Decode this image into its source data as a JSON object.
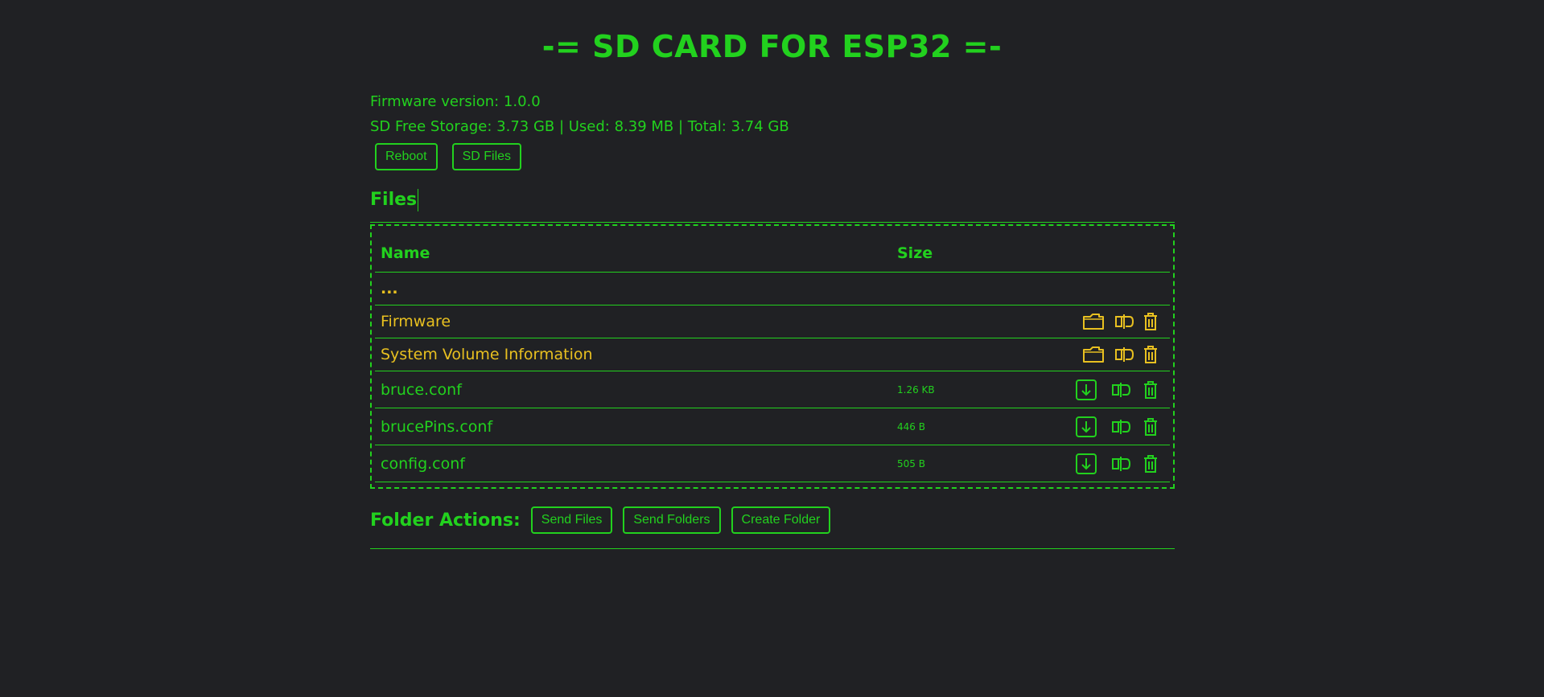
{
  "header": {
    "title": "-= SD CARD FOR ESP32 =-"
  },
  "info": {
    "firmware": "Firmware version: 1.0.0",
    "storage": "SD Free Storage: 3.73 GB | Used: 8.39 MB | Total: 3.74 GB"
  },
  "buttons": {
    "reboot": "Reboot",
    "sd_files": "SD Files"
  },
  "files": {
    "heading": "Files",
    "columns": {
      "name": "Name",
      "size": "Size"
    },
    "parent": "...",
    "folders": [
      {
        "name": "Firmware"
      },
      {
        "name": "System Volume Information"
      }
    ],
    "items": [
      {
        "name": "bruce.conf",
        "size": "1.26 KB"
      },
      {
        "name": "brucePins.conf",
        "size": "446 B"
      },
      {
        "name": "config.conf",
        "size": "505 B"
      }
    ]
  },
  "folder_actions": {
    "label": "Folder Actions:",
    "send_files": "Send Files",
    "send_folders": "Send Folders",
    "create_folder": "Create Folder"
  },
  "colors": {
    "background": "#202124",
    "accent": "#22d11e",
    "folder": "#e8c020"
  }
}
